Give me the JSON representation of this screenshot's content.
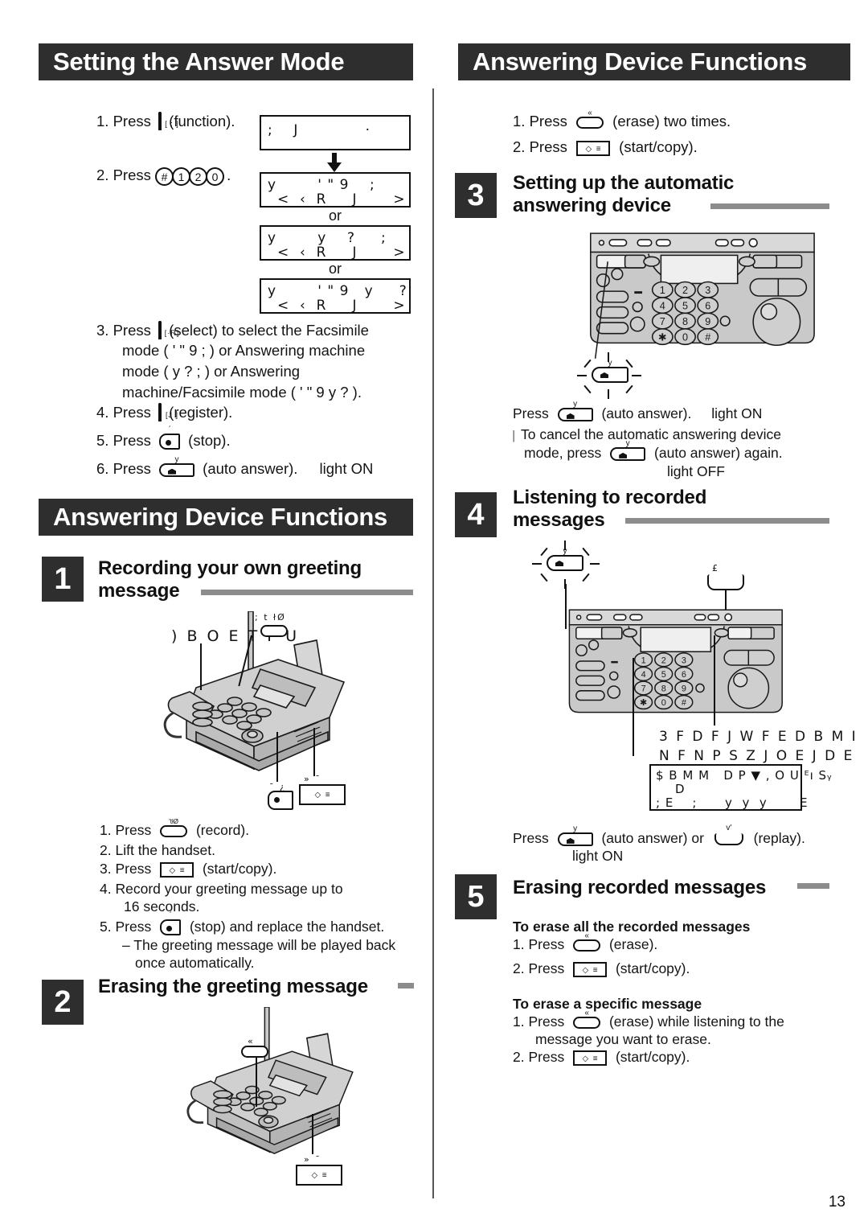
{
  "page": {
    "number": "13"
  },
  "left_column": {
    "header1": "Setting the Answer Mode",
    "steps1": [
      {
        "n": "1.",
        "pre": "Press",
        "key": "function-key",
        "post": "(function)."
      },
      {
        "n": "2.",
        "pre": "Press",
        "key": "digits-hash-1-2-0",
        "post": "."
      },
      {
        "n": "3.",
        "pre": "Press",
        "key": "select-key",
        "post": "(select) to select the Facsimile"
      },
      {
        "n": "4.",
        "pre": "Press",
        "key": "register-key",
        "post": "(register)."
      },
      {
        "n": "5.",
        "pre": "Press",
        "key": "stop-key",
        "post": "(stop)."
      },
      {
        "n": "6.",
        "pre": "Press",
        "key": "auto-answer-key",
        "post": "(auto answer).",
        "extra": "light ON"
      }
    ],
    "step3_lines": [
      "mode ( ' \" 9    ;   ) or Answering machine",
      "mode ( y   ?   ;      ) or Answering",
      "machine/Facsimile mode ( ' \" 9   y   ?  )."
    ],
    "lcd_displays": [
      {
        "l1": ";    J             ·",
        "l2": ""
      },
      {
        "l1": "y        ' \" 9    ;",
        "l2": "<  ‹  R     J       >"
      },
      {
        "l1": "y        y    ?     ;",
        "l2": "<  ‹  R     J       >"
      },
      {
        "l1": "y        ' \" 9   y     ?",
        "l2": "<  ‹  R     J       >"
      }
    ],
    "or_label": "or",
    "header2": "Answering Device Functions",
    "section1": {
      "number": "1",
      "title_line1": "Recording your own greeting",
      "title_line2": "message",
      "illustration_labels": {
        "handset": ") B O E T F U",
        "record_key": "; t łØ",
        "stop_key": "¯ ¿",
        "start_key": "»  ¯"
      },
      "steps": [
        {
          "n": "1.",
          "pre": "Press",
          "key": "record-key",
          "post": "(record)."
        },
        {
          "n": "2.",
          "text": "Lift the handset."
        },
        {
          "n": "3.",
          "pre": "Press",
          "key": "start-copy-key",
          "post": "(start/copy)."
        },
        {
          "n": "4.",
          "text": "Record your greeting message up to"
        },
        {
          "n": "",
          "text": "16 seconds."
        },
        {
          "n": "5.",
          "pre": "Press",
          "key": "stop-key",
          "post": "(stop) and replace the handset."
        }
      ],
      "dash_lines": [
        "– The greeting message will be played back",
        "once automatically."
      ]
    },
    "section2": {
      "number": "2",
      "title": "Erasing the greeting message",
      "illustration_labels": {
        "erase_key": "«",
        "start_key": "»  ¯"
      }
    }
  },
  "right_column": {
    "header1": "Answering Device Functions",
    "steps_top": [
      {
        "n": "1.",
        "pre": "Press",
        "key": "erase-key",
        "post": "(erase) two times."
      },
      {
        "n": "2.",
        "pre": "Press",
        "key": "start-copy-key",
        "post": "(start/copy)."
      }
    ],
    "section3": {
      "number": "3",
      "title_line1": "Setting up the automatic",
      "title_line2": "answering device",
      "auto_answer_label": "y",
      "body": [
        {
          "pre": "Press",
          "key": "auto-answer-key",
          "post": "(auto answer).",
          "extra": "light ON"
        },
        {
          "bullet": "│",
          "text": "To cancel the automatic answering device"
        },
        {
          "pre": "mode, press",
          "key": "auto-answer-key",
          "post": "(auto answer) again."
        },
        {
          "extra": "light OFF"
        }
      ]
    },
    "section4": {
      "number": "4",
      "title_line1": "Listening to recorded",
      "title_line2": "messages",
      "illustration_labels": {
        "auto_answer": "y",
        "replay": "£"
      },
      "lcd_messages": [
        "3 F D F J W F E   D B M I",
        "N F N P S Z   J O E J D E"
      ],
      "lcd_panel": {
        "l1": "$ B M M   D P ▼ , O U ᴱı Sᵧ        ▃▅▇",
        "l2": "D",
        "l3": "; E    ;      y  y  y       E"
      },
      "footer": {
        "pre": "Press",
        "key1": "auto-answer-key",
        "mid": "(auto answer) or",
        "key2": "replay-key",
        "post": "(replay).",
        "extra": "light ON"
      }
    },
    "section5": {
      "number": "5",
      "title": "Erasing recorded messages",
      "sub1": "To erase all the recorded messages",
      "steps1": [
        {
          "n": "1.",
          "pre": "Press",
          "key": "erase-key",
          "post": "(erase)."
        },
        {
          "n": "2.",
          "pre": "Press",
          "key": "start-copy-key",
          "post": "(start/copy)."
        }
      ],
      "sub2": "To erase a specific message",
      "steps2": [
        {
          "n": "1.",
          "pre": "Press",
          "key": "erase-key",
          "post": "(erase) while listening to the"
        },
        {
          "n": "",
          "text": "message you want to erase."
        },
        {
          "n": "2.",
          "pre": "Press",
          "key": "start-copy-key",
          "post": "(start/copy)."
        }
      ]
    }
  },
  "colors": {
    "header_bar": "#2e2e2e",
    "rule": "#8c8c8c",
    "text": "#141414",
    "machine_body": "#c9c9c9",
    "machine_line": "#1a1a1a"
  }
}
